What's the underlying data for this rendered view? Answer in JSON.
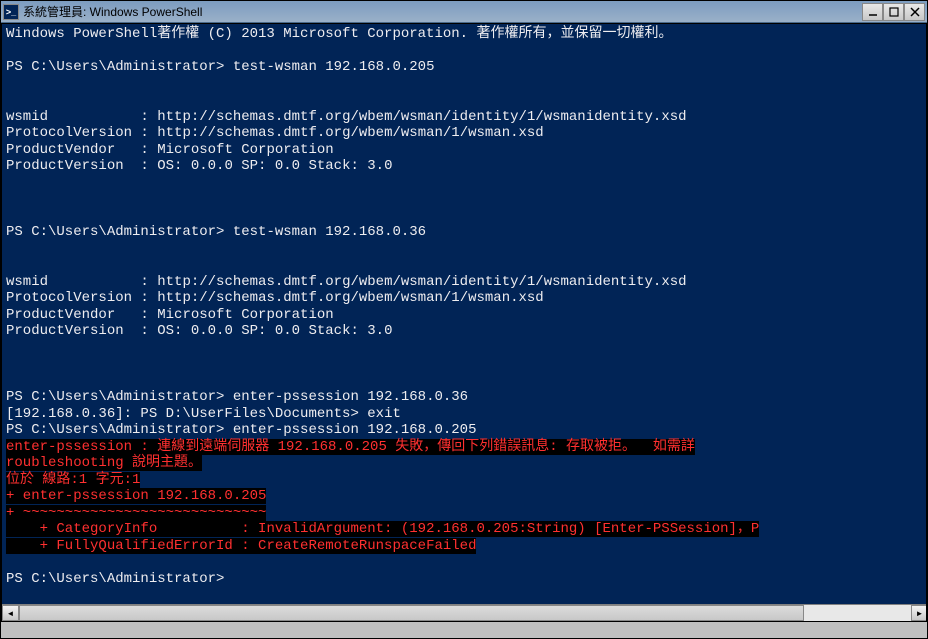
{
  "window": {
    "title": "系統管理員: Windows PowerShell",
    "icon_glyph": ">_"
  },
  "terminal": {
    "copyright": "Windows PowerShell著作權 (C) 2013 Microsoft Corporation. 著作權所有，並保留一切權利。",
    "prompt": "PS C:\\Users\\Administrator>",
    "nested_prompt": "[192.168.0.36]: PS D:\\UserFiles\\Documents>",
    "cmd1": "test-wsman 192.168.0.205",
    "cmd2": "test-wsman 192.168.0.36",
    "cmd3": "enter-pssession 192.168.0.36",
    "cmd4": "exit",
    "cmd5": "enter-pssession 192.168.0.205",
    "result": {
      "wsmid_label": "wsmid",
      "wsmid": "http://schemas.dmtf.org/wbem/wsman/identity/1/wsmanidentity.xsd",
      "protocol_label": "ProtocolVersion",
      "protocol": "http://schemas.dmtf.org/wbem/wsman/1/wsman.xsd",
      "vendor_label": "ProductVendor",
      "vendor": "Microsoft Corporation",
      "version_label": "ProductVersion",
      "version": "OS: 0.0.0 SP: 0.0 Stack: 3.0"
    },
    "error": {
      "l1": "enter-pssession : 連線到遠端伺服器 192.168.0.205 失敗，傳回下列錯誤訊息: 存取被拒。  如需詳",
      "l2": "roubleshooting 說明主題。",
      "l3": "位於 線路:1 字元:1",
      "l4": "+ enter-pssession 192.168.0.205",
      "l5": "+ ~~~~~~~~~~~~~~~~~~~~~~~~~~~~~",
      "l6": "    + CategoryInfo          : InvalidArgument: (192.168.0.205:String) [Enter-PSSession]，P",
      "l7": "    + FullyQualifiedErrorId : CreateRemoteRunspaceFailed"
    }
  }
}
